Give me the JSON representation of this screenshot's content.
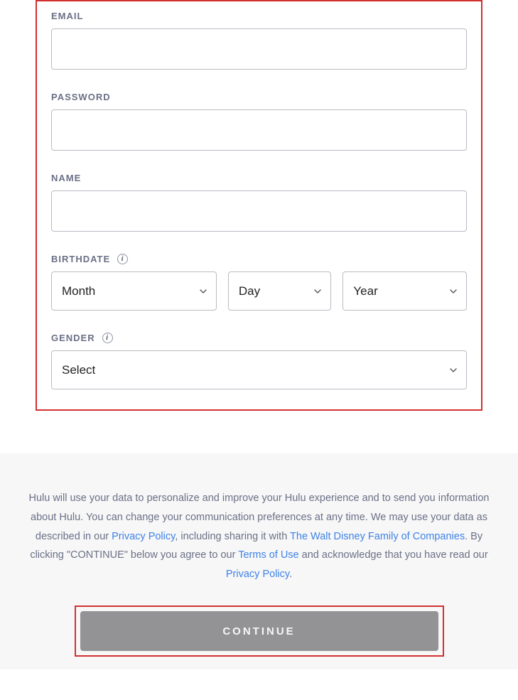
{
  "form": {
    "email": {
      "label": "EMAIL",
      "value": ""
    },
    "password": {
      "label": "PASSWORD",
      "value": ""
    },
    "name": {
      "label": "NAME",
      "value": ""
    },
    "birthdate": {
      "label": "BIRTHDATE",
      "month": "Month",
      "day": "Day",
      "year": "Year"
    },
    "gender": {
      "label": "GENDER",
      "selected": "Select"
    }
  },
  "legal": {
    "text1": "Hulu will use your data to personalize and improve your Hulu experience and to send you information about Hulu. You can change your communication preferences at any time. We may use your data as described in our ",
    "privacy_policy": "Privacy Policy",
    "text2": ", including sharing it with ",
    "disney_family": "The Walt Disney Family of Companies",
    "text3": ". By clicking \"CONTINUE\" below you agree to our ",
    "terms_of_use": "Terms of Use",
    "text4": " and acknowledge that you have read our ",
    "privacy_policy2": "Privacy Policy",
    "text5": "."
  },
  "continue_label": "CONTINUE",
  "info_glyph": "i"
}
